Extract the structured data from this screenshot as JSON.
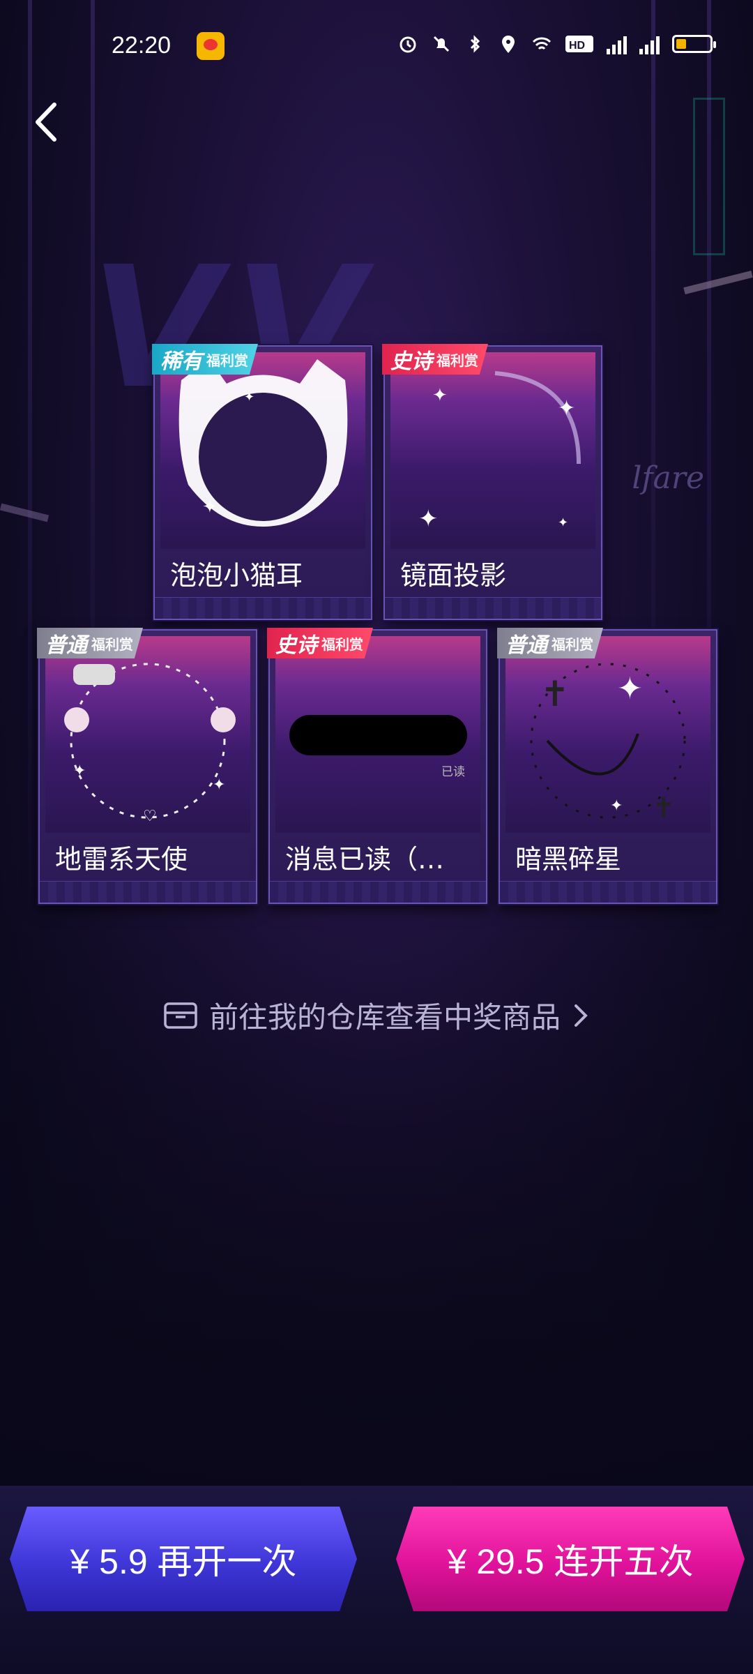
{
  "status_bar": {
    "time": "22:20"
  },
  "header": {
    "back_icon": "chevron-left-icon"
  },
  "prizes": [
    {
      "name": "泡泡小猫耳",
      "rarity": "稀有",
      "rarity_tag": "福利赏",
      "badge_color": "#2bb9d6"
    },
    {
      "name": "镜面投影",
      "rarity": "史诗",
      "rarity_tag": "福利赏",
      "badge_color": "#ef3357"
    },
    {
      "name": "地雷系天使",
      "rarity": "普通",
      "rarity_tag": "福利赏",
      "badge_color": "#9a9aaa"
    },
    {
      "name": "消息已读（…",
      "rarity": "史诗",
      "rarity_tag": "福利赏",
      "badge_color": "#ef3357",
      "bubble_text": "已读"
    },
    {
      "name": "暗黑碎星",
      "rarity": "普通",
      "rarity_tag": "福利赏",
      "badge_color": "#9a9aaa"
    }
  ],
  "bg_text": "lfare",
  "warehouse_link": {
    "label": "前往我的仓库查看中奖商品",
    "icon": "box-icon"
  },
  "actions": {
    "open_once": "¥ 5.9 再开一次",
    "open_five": "¥ 29.5 连开五次"
  }
}
